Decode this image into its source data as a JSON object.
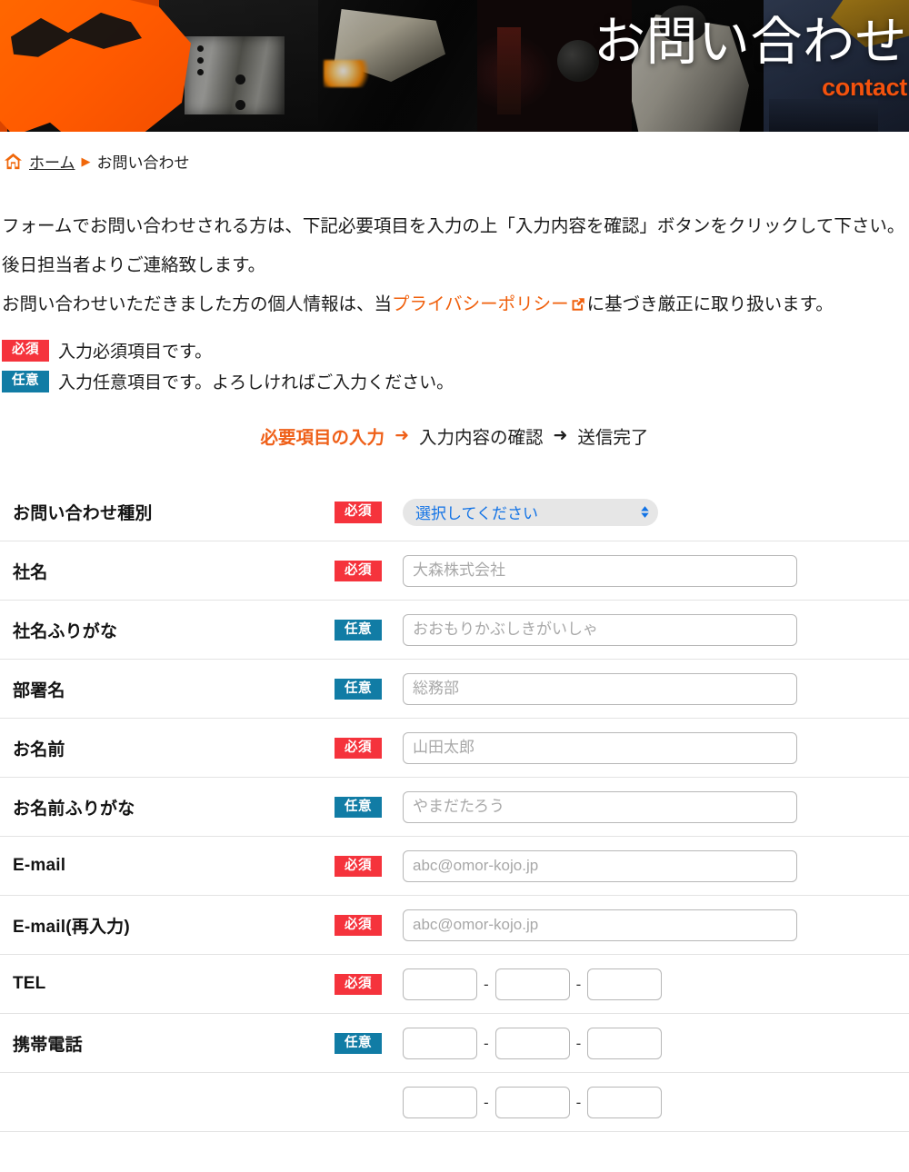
{
  "hero": {
    "title": "お問い合わせ",
    "subtitle": "contact"
  },
  "breadcrumb": {
    "home_icon": "home-icon",
    "home_label": "ホーム",
    "separator": "▶",
    "current_label": "お問い合わせ"
  },
  "intro": {
    "line1": "フォームでお問い合わせされる方は、下記必要項目を入力の上「入力内容を確認」ボタンをクリックして下さい。",
    "line2": "後日担当者よりご連絡致します。",
    "line3_prefix": "お問い合わせいただきました方の個人情報は、当",
    "privacy_link": "プライバシーポリシー",
    "external_icon": "external-link-icon",
    "line3_suffix": "に基づき厳正に取り扱います。"
  },
  "legend": {
    "required_badge": "必須",
    "required_text": "入力必須項目です。",
    "optional_badge": "任意",
    "optional_text": "入力任意項目です。よろしければご入力ください。"
  },
  "steps": {
    "step1": "必要項目の入力",
    "arrow1": "➜",
    "step2": "入力内容の確認",
    "arrow2": "➜",
    "step3": "送信完了"
  },
  "colors": {
    "required_red": "#f5333c",
    "optional_blue": "#117ca5",
    "accent_orange": "#ef6019",
    "link_orange": "#f0600d",
    "select_blue": "#1273e6"
  },
  "form": {
    "rows": [
      {
        "label": "お問い合わせ種別",
        "badge": "必須",
        "badge_type": "required",
        "field_type": "select",
        "value": "選択してください"
      },
      {
        "label": "社名",
        "badge": "必須",
        "badge_type": "required",
        "field_type": "text",
        "placeholder": "大森株式会社"
      },
      {
        "label": "社名ふりがな",
        "badge": "任意",
        "badge_type": "optional",
        "field_type": "text",
        "placeholder": "おおもりかぶしきがいしゃ"
      },
      {
        "label": "部署名",
        "badge": "任意",
        "badge_type": "optional",
        "field_type": "text",
        "placeholder": "総務部"
      },
      {
        "label": "お名前",
        "badge": "必須",
        "badge_type": "required",
        "field_type": "text",
        "placeholder": "山田太郎"
      },
      {
        "label": "お名前ふりがな",
        "badge": "任意",
        "badge_type": "optional",
        "field_type": "text",
        "placeholder": "やまだたろう"
      },
      {
        "label": "E-mail",
        "badge": "必須",
        "badge_type": "required",
        "field_type": "text",
        "placeholder": "abc@omor-kojo.jp"
      },
      {
        "label": "E-mail(再入力)",
        "badge": "必須",
        "badge_type": "required",
        "field_type": "text",
        "placeholder": "abc@omor-kojo.jp"
      },
      {
        "label": "TEL",
        "badge": "必須",
        "badge_type": "required",
        "field_type": "tel",
        "separator": "-"
      },
      {
        "label": "携帯電話",
        "badge": "任意",
        "badge_type": "optional",
        "field_type": "tel",
        "separator": "-"
      },
      {
        "label": "",
        "badge": "",
        "badge_type": "none",
        "field_type": "tel",
        "separator": "-"
      }
    ]
  }
}
